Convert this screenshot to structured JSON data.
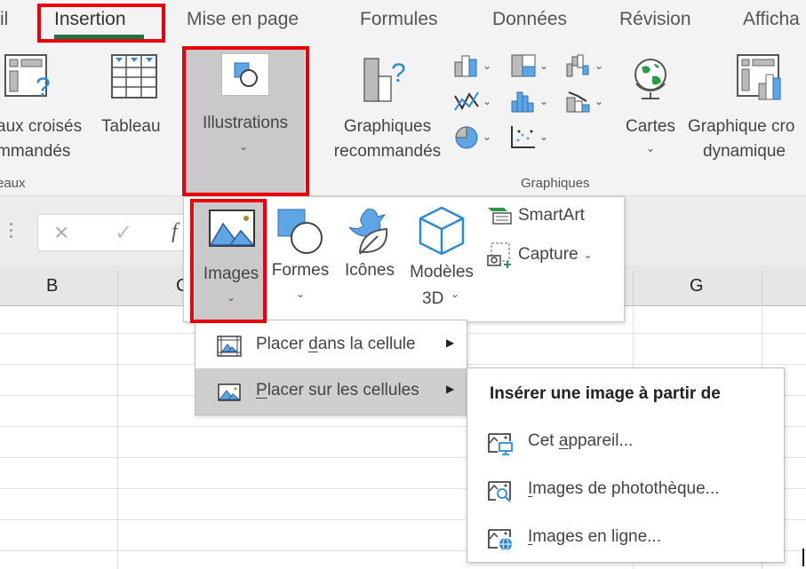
{
  "tabs": [
    {
      "label": "il",
      "active": false
    },
    {
      "label": "Insertion",
      "active": true
    },
    {
      "label": "Mise en page",
      "active": false
    },
    {
      "label": "Formules",
      "active": false
    },
    {
      "label": "Données",
      "active": false
    },
    {
      "label": "Révision",
      "active": false
    },
    {
      "label": "Afficha",
      "active": false
    }
  ],
  "ribbon": {
    "pivot_recommended": {
      "line1": "aux croisés",
      "line2": "mmandés",
      "icon": "pivot-table-question-icon"
    },
    "table": {
      "label": "Tableau",
      "icon": "table-icon"
    },
    "group_tables_label": "eaux",
    "illustrations": {
      "label": "Illustrations",
      "icon": "shapes-icon"
    },
    "recommended_charts": {
      "line1": "Graphiques",
      "line2": "recommandés",
      "icon": "recommended-charts-icon"
    },
    "chart_types": [
      {
        "name": "column-chart",
        "icon": "column-chart-icon"
      },
      {
        "name": "hierarchy-chart",
        "icon": "treemap-chart-icon"
      },
      {
        "name": "waterfall-chart",
        "icon": "waterfall-chart-icon"
      },
      {
        "name": "line-chart",
        "icon": "line-chart-icon"
      },
      {
        "name": "statistic-chart",
        "icon": "histogram-chart-icon"
      },
      {
        "name": "combo-chart",
        "icon": "combo-chart-icon"
      },
      {
        "name": "pie-chart",
        "icon": "pie-chart-icon"
      },
      {
        "name": "scatter-chart",
        "icon": "scatter-chart-icon"
      }
    ],
    "maps": {
      "label": "Cartes",
      "icon": "globe-icon"
    },
    "pivot_chart": {
      "line1": "Graphique cro",
      "line2": "dynamique",
      "icon": "pivot-chart-icon"
    },
    "group_charts_label": "Graphiques"
  },
  "formula_bar": {
    "cancel_icon": "×",
    "enter_icon": "✓",
    "fx_label": "f"
  },
  "columns": [
    "B",
    "C",
    "G"
  ],
  "illustrations_panel": {
    "images": {
      "label": "Images",
      "icon": "picture-icon"
    },
    "shapes": {
      "label": "Formes",
      "icon": "shapes-icon"
    },
    "icons": {
      "label": "Icônes",
      "icon": "icons-icon"
    },
    "models3d": {
      "line1": "Modèles",
      "line2": "3D",
      "icon": "cube-icon"
    },
    "smartart": {
      "label": "SmartArt",
      "icon": "smartart-icon"
    },
    "capture": {
      "label": "Capture",
      "icon": "screenshot-icon"
    }
  },
  "images_menu": [
    {
      "label_pre": "Placer ",
      "label_u": "d",
      "label_post": "ans la cellule",
      "highlighted": false
    },
    {
      "label_pre": "",
      "label_u": "P",
      "label_post": "lacer sur les cellules",
      "highlighted": true
    }
  ],
  "insert_from_menu": {
    "title": "Insérer une image à partir de",
    "items": [
      {
        "label_pre": "Cet ",
        "label_u": "a",
        "label_post": "ppareil...",
        "icon": "this-device-icon"
      },
      {
        "label_pre": "",
        "label_u": "I",
        "label_post": "mages de photothèque...",
        "icon": "stock-images-icon"
      },
      {
        "label_pre": "",
        "label_u": "I",
        "label_post": "mages en ligne...",
        "icon": "online-pictures-icon"
      }
    ]
  },
  "colors": {
    "highlight_red": "#e8000b",
    "excel_green": "#217346",
    "accent_blue": "#4a90d9"
  }
}
